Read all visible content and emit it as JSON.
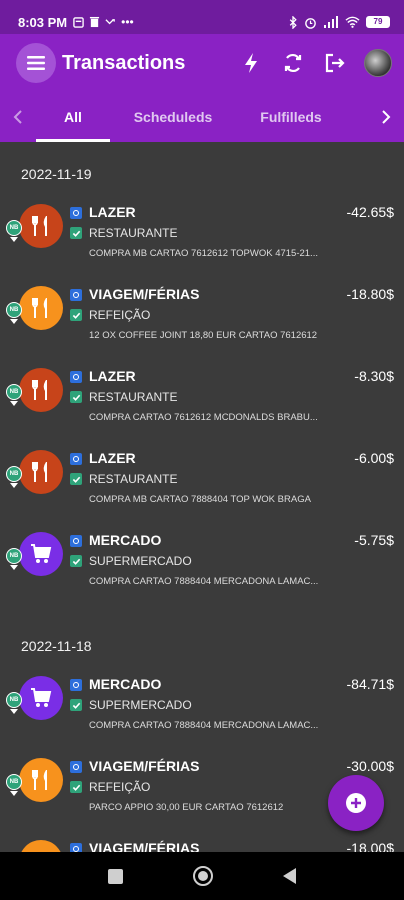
{
  "status_bar": {
    "time": "8:03 PM",
    "battery": "79"
  },
  "app_bar": {
    "title": "Transactions"
  },
  "tabs": [
    {
      "label": "All",
      "selected": true
    },
    {
      "label": "Scheduleds",
      "selected": false
    },
    {
      "label": "Fulfilleds",
      "selected": false
    }
  ],
  "groups": [
    {
      "date": "2022-11-19",
      "transactions": [
        {
          "category": "LAZER",
          "subcategory": "RESTAURANTE",
          "description": "COMPRA MB CARTAO 7612612 TOPWOK 4715-21...",
          "amount": "-42.65$",
          "color": "#c7441a",
          "icon": "fork-knife-icon",
          "badge": "NB"
        },
        {
          "category": "VIAGEM/FÉRIAS",
          "subcategory": "REFEIÇÃO",
          "description": "12 OX COFFEE JOINT 18,80 EUR CARTAO 7612612",
          "amount": "-18.80$",
          "color": "#f7921d",
          "icon": "fork-knife-icon",
          "badge": "NB"
        },
        {
          "category": "LAZER",
          "subcategory": "RESTAURANTE",
          "description": "COMPRA CARTAO 7612612 MCDONALDS BRABU...",
          "amount": "-8.30$",
          "color": "#c7441a",
          "icon": "fork-knife-icon",
          "badge": "NB"
        },
        {
          "category": "LAZER",
          "subcategory": "RESTAURANTE",
          "description": "COMPRA MB CARTAO 7888404 TOP WOK BRAGA",
          "amount": "-6.00$",
          "color": "#c7441a",
          "icon": "fork-knife-icon",
          "badge": "NB"
        },
        {
          "category": "MERCADO",
          "subcategory": "SUPERMERCADO",
          "description": "COMPRA CARTAO 7888404 MERCADONA LAMAC...",
          "amount": "-5.75$",
          "color": "#7a2ee6",
          "icon": "shopping-cart-icon",
          "badge": "NB"
        }
      ]
    },
    {
      "date": "2022-11-18",
      "transactions": [
        {
          "category": "MERCADO",
          "subcategory": "SUPERMERCADO",
          "description": "COMPRA CARTAO 7888404 MERCADONA LAMAC...",
          "amount": "-84.71$",
          "color": "#7a2ee6",
          "icon": "shopping-cart-icon",
          "badge": "NB"
        },
        {
          "category": "VIAGEM/FÉRIAS",
          "subcategory": "REFEIÇÃO",
          "description": "PARCO APPIO 30,00 EUR CARTAO 7612612",
          "amount": "-30.00$",
          "color": "#f7921d",
          "icon": "fork-knife-icon",
          "badge": "NB"
        },
        {
          "category": "VIAGEM/FÉRIAS",
          "subcategory": "",
          "description": "",
          "amount": "-18.00$",
          "color": "#f7921d",
          "icon": "fork-knife-icon",
          "badge": "NB"
        }
      ]
    }
  ],
  "colors": {
    "accent": "#8a22c4",
    "status_bar": "#6f1c9e",
    "background": "#3b3b3b"
  }
}
